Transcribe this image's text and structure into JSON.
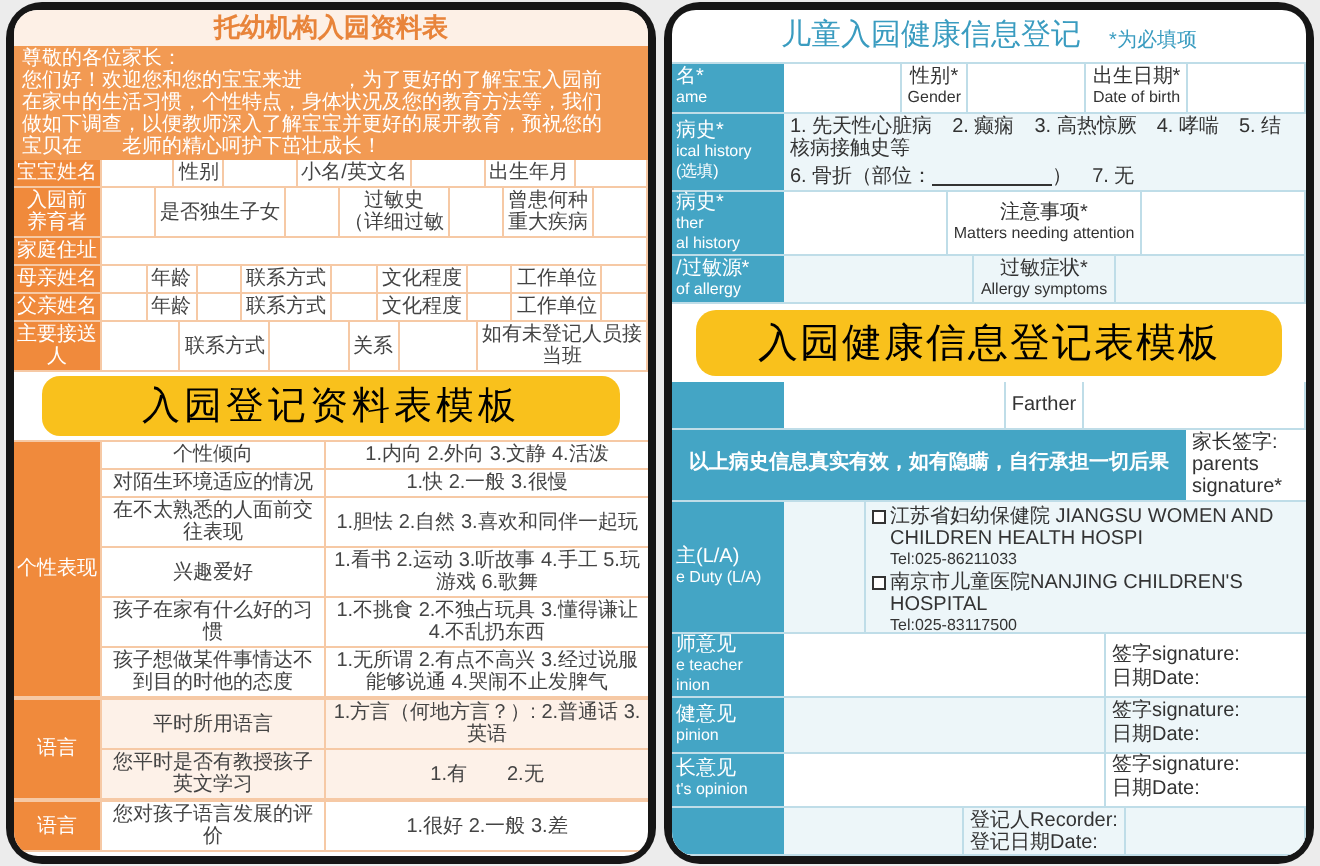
{
  "left_form": {
    "title": "托幼机构入园资料表",
    "greeting": "尊敬的各位家长：",
    "intro": "您们好！欢迎您和您的宝宝来进　　，为了更好的了解宝宝入园前在家中的生活习惯，个性特点，身体状况及您的教育方法等，我们做如下调查，以便教师深入了解宝宝并更好的展开教育，预祝您的宝贝在　　老师的精心呵护下茁壮成长！",
    "rows": [
      [
        {
          "kind": "label",
          "lines": [
            "宝宝姓名"
          ]
        },
        {
          "kind": "blank"
        },
        {
          "kind": "text",
          "lines": [
            "性别"
          ]
        },
        {
          "kind": "blank"
        },
        {
          "kind": "text",
          "lines": [
            "小名/英文名"
          ]
        },
        {
          "kind": "blank"
        },
        {
          "kind": "text",
          "lines": [
            "出生年月"
          ]
        },
        {
          "kind": "blank"
        }
      ],
      [
        {
          "kind": "label",
          "lines": [
            "入园前",
            "养育者"
          ]
        },
        {
          "kind": "blank"
        },
        {
          "kind": "text",
          "lines": [
            "是否独生子女"
          ]
        },
        {
          "kind": "blank"
        },
        {
          "kind": "text",
          "lines": [
            "过敏史",
            "（详细过敏"
          ]
        },
        {
          "kind": "blank"
        },
        {
          "kind": "text",
          "lines": [
            "曾患何种",
            "重大疾病"
          ]
        },
        {
          "kind": "blank"
        }
      ],
      [
        {
          "kind": "label",
          "lines": [
            "家庭住址"
          ]
        },
        {
          "kind": "blank"
        }
      ],
      [
        {
          "kind": "label",
          "lines": [
            "母亲姓名"
          ]
        },
        {
          "kind": "blank"
        },
        {
          "kind": "text",
          "lines": [
            "年龄"
          ]
        },
        {
          "kind": "blank"
        },
        {
          "kind": "text",
          "lines": [
            "联系方式"
          ]
        },
        {
          "kind": "blank"
        },
        {
          "kind": "text",
          "lines": [
            "文化程度"
          ]
        },
        {
          "kind": "blank"
        },
        {
          "kind": "text",
          "lines": [
            "工作单位"
          ]
        },
        {
          "kind": "blank"
        }
      ],
      [
        {
          "kind": "label",
          "lines": [
            "父亲姓名"
          ]
        },
        {
          "kind": "blank"
        },
        {
          "kind": "text",
          "lines": [
            "年龄"
          ]
        },
        {
          "kind": "blank"
        },
        {
          "kind": "text",
          "lines": [
            "联系方式"
          ]
        },
        {
          "kind": "blank"
        },
        {
          "kind": "text",
          "lines": [
            "文化程度"
          ]
        },
        {
          "kind": "blank"
        },
        {
          "kind": "text",
          "lines": [
            "工作单位"
          ]
        },
        {
          "kind": "blank"
        }
      ],
      [
        {
          "kind": "label",
          "lines": [
            "主要接送",
            "人"
          ]
        },
        {
          "kind": "blank"
        },
        {
          "kind": "text",
          "lines": [
            "联系方式"
          ]
        },
        {
          "kind": "blank"
        },
        {
          "kind": "text",
          "lines": [
            "关系"
          ]
        },
        {
          "kind": "blank"
        },
        {
          "kind": "text",
          "lines": [
            "如有未登记人员接",
            "当班"
          ]
        }
      ]
    ],
    "banner": "入园登记资料表模板",
    "sections": [
      {
        "label": "个性表现",
        "items": [
          {
            "question": "个性倾向",
            "answer": "1.内向 2.外向 3.文静 4.活泼"
          },
          {
            "question": "对陌生环境适应的情况",
            "answer": "1.快 2.一般 3.很慢"
          },
          {
            "question": "在不太熟悉的人面前交往表现",
            "answer": "1.胆怯 2.自然 3.喜欢和同伴一起玩"
          },
          {
            "question": "兴趣爱好",
            "answer": "1.看书 2.运动 3.听故事 4.手工 5.玩游戏 6.歌舞"
          },
          {
            "question": "孩子在家有什么好的习惯",
            "answer": "1.不挑食 2.不独占玩具 3.懂得谦让 4.不乱扔东西"
          },
          {
            "question": "孩子想做某件事情达不到目的时他的态度",
            "answer": "1.无所谓 2.有点不高兴 3.经过说服能够说通 4.哭闹不止发脾气"
          }
        ]
      },
      {
        "label": "语言",
        "items": [
          {
            "question": "平时所用语言",
            "answer": "1.方言（何地方言？）: 2.普通话 3.英语"
          },
          {
            "question": "您平时是否有教授孩子英文学习",
            "answer": "1.有　　2.无"
          }
        ]
      },
      {
        "label": "语言",
        "items": [
          {
            "question": "您对孩子语言发展的评价",
            "answer": "1.很好 2.一般 3.差"
          }
        ]
      }
    ]
  },
  "right_form": {
    "title": "儿童入园健康信息登记",
    "note": "*为必填项",
    "rows": [
      {
        "kind": "row",
        "label": {
          "zh": "名*",
          "en": [
            "ame"
          ]
        },
        "cells": [
          {
            "kind": "blank"
          },
          {
            "kind": "pair",
            "zh": "性别*",
            "en": "Gender"
          },
          {
            "kind": "blank"
          },
          {
            "kind": "pair",
            "zh": "出生日期*",
            "en": "Date of birth"
          },
          {
            "kind": "blank"
          }
        ]
      },
      {
        "kind": "row",
        "label": {
          "zh": "病史*",
          "en": [
            "ical history",
            "(选填)"
          ]
        },
        "cells": [
          {
            "kind": "history",
            "line1": "1. 先天性心脏病　2. 癫痫　3. 高热惊厥　4. 哮喘　5. 结核病接触史等",
            "before": "6. 骨折（部位：",
            "after": "）　7. 无"
          }
        ]
      },
      {
        "kind": "row",
        "label": {
          "zh": "病史*",
          "en": [
            "ther",
            "al history"
          ]
        },
        "cells": [
          {
            "kind": "blank"
          },
          {
            "kind": "pair",
            "zh": "注意事项*",
            "en": "Matters needing attention"
          },
          {
            "kind": "blank"
          }
        ]
      },
      {
        "kind": "row",
        "label": {
          "zh": "/过敏源*",
          "en": [
            "of allergy"
          ]
        },
        "cells": [
          {
            "kind": "blank"
          },
          {
            "kind": "pair",
            "zh": "过敏症状*",
            "en": "Allergy symptoms"
          },
          {
            "kind": "blank"
          }
        ]
      },
      {
        "kind": "banner",
        "text": "入园健康信息登记表模板"
      },
      {
        "kind": "row",
        "cells": [
          {
            "kind": "blank"
          },
          {
            "kind": "lines",
            "lines": [
              "Farther"
            ]
          },
          {
            "kind": "blank"
          }
        ]
      },
      {
        "kind": "notice",
        "text": "以上病史信息真实有效，如有隐瞒，自行承担一切后果",
        "side": [
          "家长签字:",
          "parents",
          "signature*"
        ]
      },
      {
        "kind": "row",
        "label": {
          "zh": "主(L/A)",
          "en": [
            "e Duty (L/A)"
          ]
        },
        "cells": [
          {
            "kind": "blank"
          },
          {
            "kind": "hospitals",
            "items": [
              {
                "name": "江苏省妇幼保健院 JIANGSU WOMEN AND CHILDREN HEALTH HOSPI",
                "tel": "Tel:025-86211033",
                "checked": false
              },
              {
                "name": "南京市儿童医院NANJING CHILDREN'S HOSPITAL",
                "tel": "Tel:025-83117500",
                "checked": false
              }
            ]
          }
        ]
      },
      {
        "kind": "row",
        "label": {
          "zh": "师意见",
          "en": [
            "e teacher",
            "inion"
          ]
        },
        "cells": [
          {
            "kind": "blank"
          },
          {
            "kind": "signature",
            "lines": [
              "签字signature:",
              "日期Date:"
            ]
          }
        ]
      },
      {
        "kind": "row",
        "label": {
          "zh": "健意见",
          "en": [
            "pinion"
          ]
        },
        "cells": [
          {
            "kind": "blank"
          },
          {
            "kind": "signature",
            "lines": [
              "签字signature:",
              "日期Date:"
            ]
          }
        ]
      },
      {
        "kind": "row",
        "label": {
          "zh": "长意见",
          "en": [
            "t's opinion"
          ]
        },
        "cells": [
          {
            "kind": "blank"
          },
          {
            "kind": "signature",
            "lines": [
              "签字signature:",
              "日期Date:"
            ]
          }
        ]
      },
      {
        "kind": "row",
        "cells": [
          {
            "kind": "blank"
          },
          {
            "kind": "lines",
            "lines": [
              "登记人Recorder:",
              "登记日期Date:"
            ]
          },
          {
            "kind": "blank"
          }
        ]
      }
    ]
  }
}
